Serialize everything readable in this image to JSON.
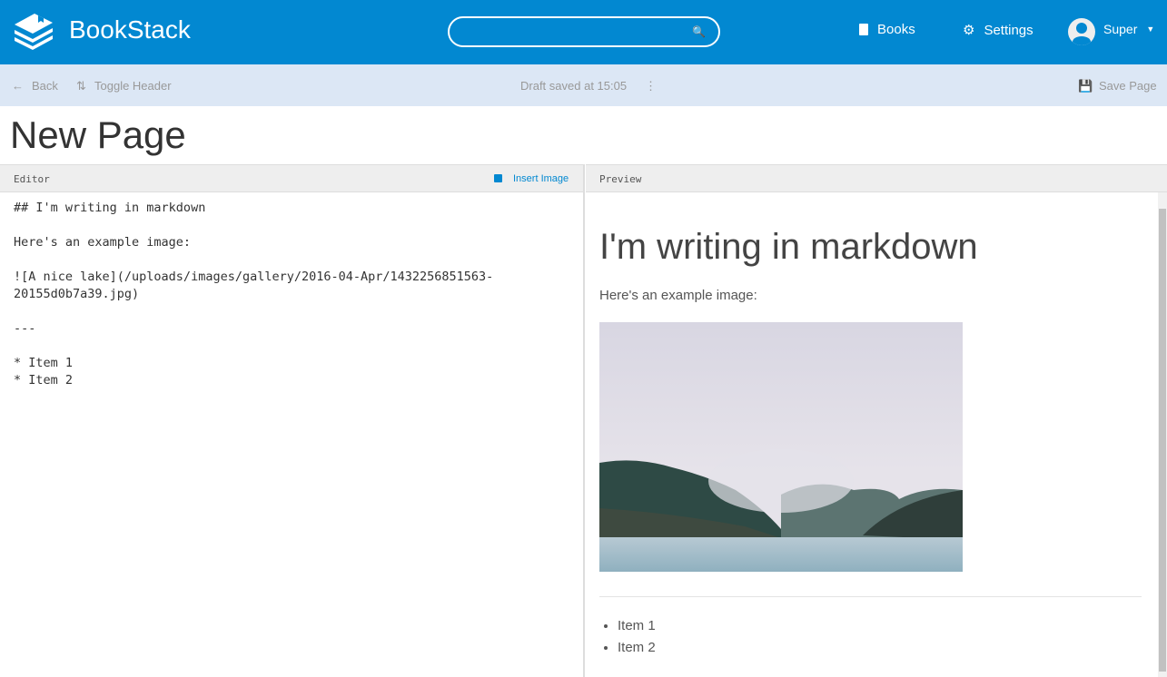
{
  "header": {
    "brand": "BookStack",
    "search_placeholder": "",
    "nav": {
      "books": "Books",
      "settings": "Settings",
      "user": "Super"
    },
    "color": "#0288d1"
  },
  "toolbar": {
    "back": "Back",
    "toggle_header": "Toggle Header",
    "draft_status": "Draft saved at 15:05",
    "save": "Save Page"
  },
  "page": {
    "title": "New Page"
  },
  "editor": {
    "label": "Editor",
    "insert_image": "Insert Image",
    "content": "## I'm writing in markdown\n\nHere's an example image:\n\n![A nice lake](/uploads/images/gallery/2016-04-Apr/1432256851563-\n20155d0b7a39.jpg)\n\n---\n\n* Item 1\n* Item 2"
  },
  "preview": {
    "label": "Preview",
    "heading": "I'm writing in markdown",
    "paragraph": "Here's an example image:",
    "image_alt": "A nice lake",
    "items": [
      "Item 1",
      "Item 2"
    ]
  }
}
